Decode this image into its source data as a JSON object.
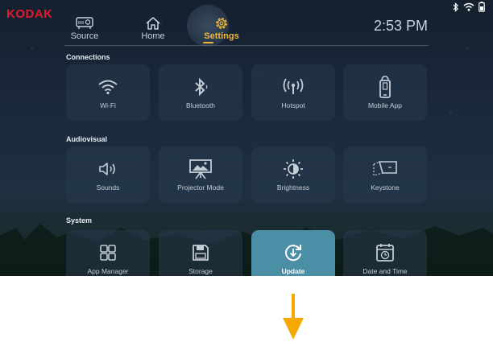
{
  "brand": {
    "logo": "KODAK"
  },
  "status_bar": {
    "icons": [
      "bluetooth-icon",
      "wifi-icon",
      "battery-icon"
    ]
  },
  "nav": {
    "items": [
      {
        "label": "Source",
        "icon": "projector-icon",
        "active": false
      },
      {
        "label": "Home",
        "icon": "home-icon",
        "active": false
      },
      {
        "label": "Settings",
        "icon": "gear-icon",
        "active": true
      }
    ]
  },
  "clock": "2:53 PM",
  "sections": [
    {
      "title": "Connections",
      "tiles": [
        {
          "label": "Wi-Fi",
          "icon": "wifi-icon"
        },
        {
          "label": "Bluetooth",
          "icon": "bluetooth-icon"
        },
        {
          "label": "Hotspot",
          "icon": "hotspot-icon"
        },
        {
          "label": "Mobile App",
          "icon": "mobile-app-icon"
        }
      ]
    },
    {
      "title": "Audiovisual",
      "tiles": [
        {
          "label": "Sounds",
          "icon": "speaker-icon"
        },
        {
          "label": "Projector Mode",
          "icon": "projector-screen-icon"
        },
        {
          "label": "Brightness",
          "icon": "brightness-icon"
        },
        {
          "label": "Keystone",
          "icon": "keystone-icon"
        }
      ]
    },
    {
      "title": "System",
      "tiles": [
        {
          "label": "App Manager",
          "icon": "app-grid-icon"
        },
        {
          "label": "Storage",
          "icon": "save-icon"
        },
        {
          "label": "Update",
          "icon": "update-icon",
          "selected": true
        },
        {
          "label": "Date and Time",
          "icon": "calendar-clock-icon"
        }
      ]
    }
  ],
  "colors": {
    "accent": "#f2b63a",
    "selected_tile": "#4a8fa6",
    "logo": "#e11c2a",
    "arrow": "#f5a800"
  },
  "annotation": {
    "icon": "arrow-down-icon"
  }
}
